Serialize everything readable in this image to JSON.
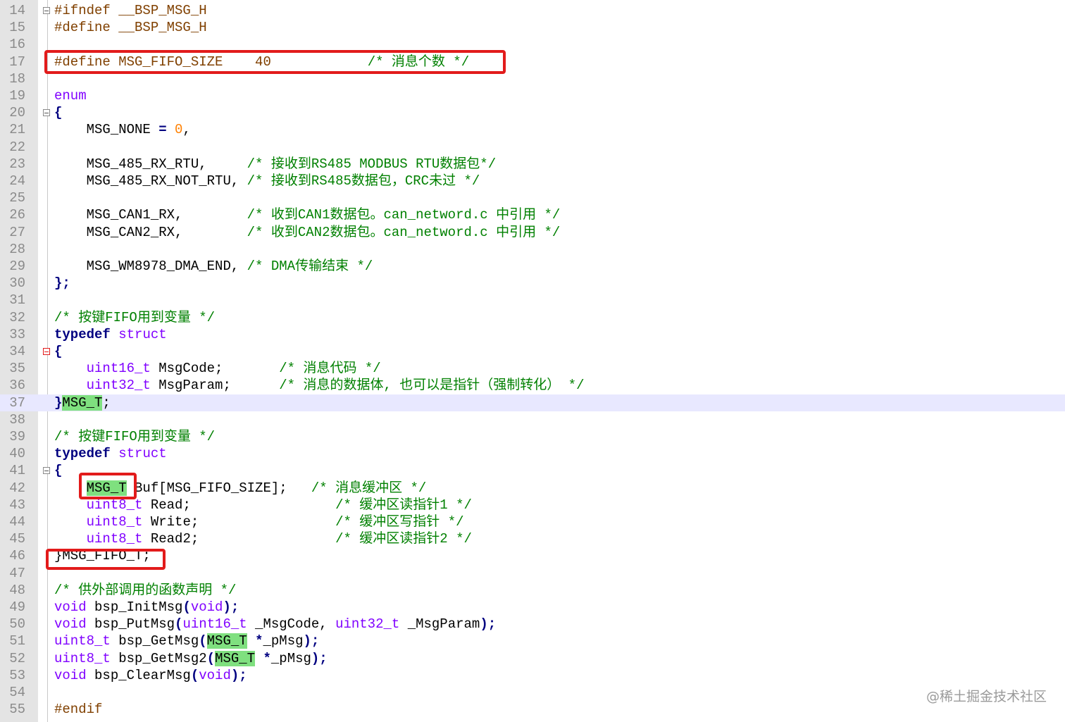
{
  "editor": {
    "lines": [
      {
        "num": "14",
        "fold": true
      },
      {
        "num": "15"
      },
      {
        "num": "16"
      },
      {
        "num": "17"
      },
      {
        "num": "18"
      },
      {
        "num": "19"
      },
      {
        "num": "20",
        "fold": true
      },
      {
        "num": "21"
      },
      {
        "num": "22"
      },
      {
        "num": "23"
      },
      {
        "num": "24"
      },
      {
        "num": "25"
      },
      {
        "num": "26"
      },
      {
        "num": "27"
      },
      {
        "num": "28"
      },
      {
        "num": "29"
      },
      {
        "num": "30"
      },
      {
        "num": "31"
      },
      {
        "num": "32"
      },
      {
        "num": "33"
      },
      {
        "num": "34",
        "fold": true,
        "fold_color": "red"
      },
      {
        "num": "35"
      },
      {
        "num": "36"
      },
      {
        "num": "37",
        "current": true
      },
      {
        "num": "38"
      },
      {
        "num": "39"
      },
      {
        "num": "40"
      },
      {
        "num": "41",
        "fold": true
      },
      {
        "num": "42"
      },
      {
        "num": "43"
      },
      {
        "num": "44"
      },
      {
        "num": "45"
      },
      {
        "num": "46"
      },
      {
        "num": "47"
      },
      {
        "num": "48"
      },
      {
        "num": "49"
      },
      {
        "num": "50"
      },
      {
        "num": "51"
      },
      {
        "num": "52"
      },
      {
        "num": "53"
      },
      {
        "num": "54"
      },
      {
        "num": "55"
      }
    ],
    "code": {
      "l14": {
        "a": "#ifndef __BSP_MSG_H"
      },
      "l15": {
        "a": "#define __BSP_MSG_H"
      },
      "l17": {
        "a": "#define MSG_FIFO_SIZE    40",
        "b": "/* 消息个数 */"
      },
      "l19": {
        "a": "enum"
      },
      "l20": {
        "a": "{"
      },
      "l21": {
        "a": "    MSG_NONE ",
        "op": "=",
        "sp": " ",
        "num": "0",
        "end": ","
      },
      "l23": {
        "a": "    MSG_485_RX_RTU,     ",
        "b": "/* 接收到RS485 MODBUS RTU数据包*/"
      },
      "l24": {
        "a": "    MSG_485_RX_NOT_RTU, ",
        "b": "/* 接收到RS485数据包，CRC未过 */"
      },
      "l26": {
        "a": "    MSG_CAN1_RX,        ",
        "b": "/* 收到CAN1数据包。can_netword.c 中引用 */"
      },
      "l27": {
        "a": "    MSG_CAN2_RX,        ",
        "b": "/* 收到CAN2数据包。can_netword.c 中引用 */"
      },
      "l29": {
        "a": "    MSG_WM8978_DMA_END, ",
        "b": "/* DMA传输结束 */"
      },
      "l30": {
        "a": "};"
      },
      "l32": {
        "b": "/* 按键FIFO用到变量 */"
      },
      "l33": {
        "kw": "typedef",
        "ty": "struct"
      },
      "l34": {
        "a": "{"
      },
      "l35": {
        "ind": "    ",
        "ty": "uint16_t",
        "a": " MsgCode;       ",
        "b": "/* 消息代码 */"
      },
      "l36": {
        "ind": "    ",
        "ty": "uint32_t",
        "a": " MsgParam;      ",
        "b": "/* 消息的数据体, 也可以是指针（强制转化） */"
      },
      "l37": {
        "a": "}",
        "hl": "MSG_T",
        "end": ";"
      },
      "l39": {
        "b": "/* 按键FIFO用到变量 */"
      },
      "l40": {
        "kw": "typedef",
        "ty": "struct"
      },
      "l41": {
        "a": "{"
      },
      "l42": {
        "ind": "    ",
        "hl": "MSG_T",
        "a": " Buf[MSG_FIFO_SIZE];   ",
        "b": "/* 消息缓冲区 */"
      },
      "l43": {
        "ind": "    ",
        "ty": "uint8_t",
        "a": " Read;                  ",
        "b": "/* 缓冲区读指针1 */"
      },
      "l44": {
        "ind": "    ",
        "ty": "uint8_t",
        "a": " Write;                 ",
        "b": "/* 缓冲区写指针 */"
      },
      "l45": {
        "ind": "    ",
        "ty": "uint8_t",
        "a": " Read2;                 ",
        "b": "/* 缓冲区读指针2 */"
      },
      "l46": {
        "a": "}MSG_FIFO_T;"
      },
      "l48": {
        "b": "/* 供外部调用的函数声明 */"
      },
      "l49": {
        "ty1": "void",
        "a": " bsp_InitMsg",
        "p1": "(",
        "ty2": "void",
        "p2": ");"
      },
      "l50": {
        "ty1": "void",
        "a": " bsp_PutMsg",
        "p1": "(",
        "ty2": "uint16_t",
        "a2": " _MsgCode, ",
        "ty3": "uint32_t",
        "a3": " _MsgParam",
        "p2": ");"
      },
      "l51": {
        "ty1": "uint8_t",
        "a": " bsp_GetMsg",
        "p1": "(",
        "hl": "MSG_T",
        "a2": " ",
        "op": "*",
        "a3": "_pMsg",
        "p2": ");"
      },
      "l52": {
        "ty1": "uint8_t",
        "a": " bsp_GetMsg2",
        "p1": "(",
        "hl": "MSG_T",
        "a2": " ",
        "op": "*",
        "a3": "_pMsg",
        "p2": ");"
      },
      "l53": {
        "ty1": "void",
        "a": " bsp_ClearMsg",
        "p1": "(",
        "ty2": "void",
        "p2": ");"
      },
      "l55": {
        "a": "#endif"
      }
    }
  },
  "watermark": "@稀土掘金技术社区",
  "colors": {
    "highlight_box": "#e21b1b",
    "keyword": "#000080",
    "type": "#8000ff",
    "comment": "#008000",
    "preprocessor": "#804000",
    "number": "#ff8000",
    "selection": "#7fe07f"
  }
}
